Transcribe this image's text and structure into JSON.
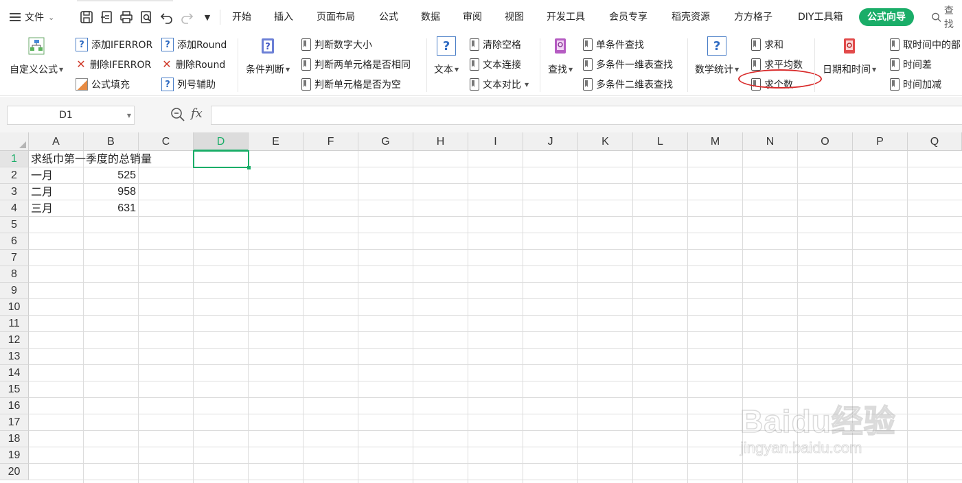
{
  "menubar": {
    "file_label": "文件",
    "tabs": [
      "开始",
      "插入",
      "页面布局",
      "公式",
      "数据",
      "审阅",
      "视图",
      "开发工具",
      "会员专享",
      "稻壳资源",
      "方方格子",
      "DIY工具箱"
    ],
    "active_tab": "公式向导",
    "search_label": "查找",
    "accent_color": "#1aad68"
  },
  "ribbon": {
    "custom_formula": "自定义公式",
    "add_iferror": "添加IFERROR",
    "del_iferror": "删除IFERROR",
    "formula_fill": "公式填充",
    "add_round": "添加Round",
    "del_round": "删除Round",
    "col_helper": "列号辅助",
    "cond_judge": "条件判断",
    "judge_size": "判断数字大小",
    "judge_same": "判断两单元格是否相同",
    "judge_empty": "判断单元格是否为空",
    "text": "文本",
    "clear_space": "清除空格",
    "text_join": "文本连接",
    "text_compare": "文本对比",
    "find": "查找",
    "single_find": "单条件查找",
    "multi_find_1d": "多条件一维表查找",
    "multi_find_2d": "多条件二维表查找",
    "math_stats": "数学统计",
    "sum": "求和",
    "average": "求平均数",
    "count": "求个数",
    "date_time": "日期和时间",
    "get_time_part": "取时间中的部",
    "time_diff": "时间差",
    "time_add": "时间加减",
    "highlight_color": "#d92b2b"
  },
  "formula_bar": {
    "name_box": "D1",
    "fx_label": "fx",
    "formula": ""
  },
  "sheet": {
    "columns": [
      "A",
      "B",
      "C",
      "D",
      "E",
      "F",
      "G",
      "H",
      "I",
      "J",
      "K",
      "L",
      "M",
      "N",
      "O",
      "P",
      "Q"
    ],
    "rows": [
      "1",
      "2",
      "3",
      "4",
      "5",
      "6",
      "7",
      "8",
      "9",
      "10",
      "11",
      "12",
      "13",
      "14",
      "15",
      "16",
      "17",
      "18",
      "19",
      "20"
    ],
    "active_cell": "D1",
    "cells": {
      "A1": "求纸巾第一季度的总销量",
      "A2": "一月",
      "B2": "525",
      "A3": "二月",
      "B3": "958",
      "A4": "三月",
      "B4": "631"
    }
  },
  "watermark": {
    "brand": "Baidu经验",
    "url": "jingyan.baidu.com"
  }
}
